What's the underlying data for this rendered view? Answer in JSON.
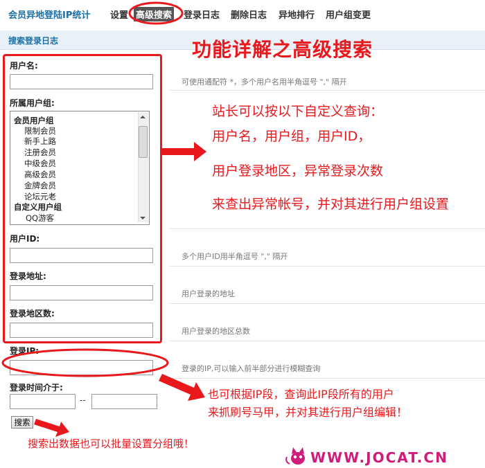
{
  "app_title": "会员异地登陆IP统计",
  "nav": [
    "设置",
    "高级搜索",
    "登录日志",
    "删除日志",
    "异地排行",
    "用户组变更"
  ],
  "section_title": "搜索登录日志",
  "fields": {
    "username": {
      "label": "用户名:",
      "value": "",
      "hint": "可使用通配符 *，多个用户名用半角逗号 \",\" 隔开"
    },
    "usergroup": {
      "label": "所属用户组:"
    },
    "userid": {
      "label": "用户ID:",
      "value": "",
      "hint": "多个用户ID用半角逗号 \",\" 隔开"
    },
    "address": {
      "label": "登录地址:",
      "value": "",
      "hint": "用户登录的地址"
    },
    "region_count": {
      "label": "登录地区数:",
      "value": "",
      "hint": "用户登录的地区总数"
    },
    "ip": {
      "label": "登录IP:",
      "value": "",
      "hint": "登录的IP,可以输入前半部分进行模糊查询"
    },
    "time": {
      "label": "登录时间介于:",
      "separator": "--",
      "from": "",
      "to": ""
    }
  },
  "group_options": [
    {
      "text": "会员用户组",
      "kind": "group"
    },
    {
      "text": "限制会员",
      "kind": "item"
    },
    {
      "text": "新手上路",
      "kind": "item"
    },
    {
      "text": "注册会员",
      "kind": "item"
    },
    {
      "text": "中级会员",
      "kind": "item"
    },
    {
      "text": "高级会员",
      "kind": "item"
    },
    {
      "text": "金牌会员",
      "kind": "item"
    },
    {
      "text": "论坛元老",
      "kind": "item"
    },
    {
      "text": "自定义用户组",
      "kind": "group"
    },
    {
      "text": "QQ游客",
      "kind": "item"
    }
  ],
  "search_button": "搜索",
  "annotations": {
    "heading": "功能详解之高级搜索",
    "main_lines": [
      "站长可以按以下自定义查询：",
      "用户名，用户组，用户ID，",
      "用户登录地区，异常登录次数",
      "来查出异常帐号，并对其进行用户组设置"
    ],
    "ip_lines": [
      "也可根据IP段，查询此IP段所有的用户",
      "来抓刷号马甲，并对其进行用户组编辑！"
    ],
    "bottom_note": "搜索出数据也可以批量设置分组哦！",
    "watermark": "WWW.JOCAT.CN"
  },
  "colors": {
    "annotation_red": "#e8181d",
    "title_blue": "#1b6fa6",
    "watermark": "#d01b7b"
  }
}
